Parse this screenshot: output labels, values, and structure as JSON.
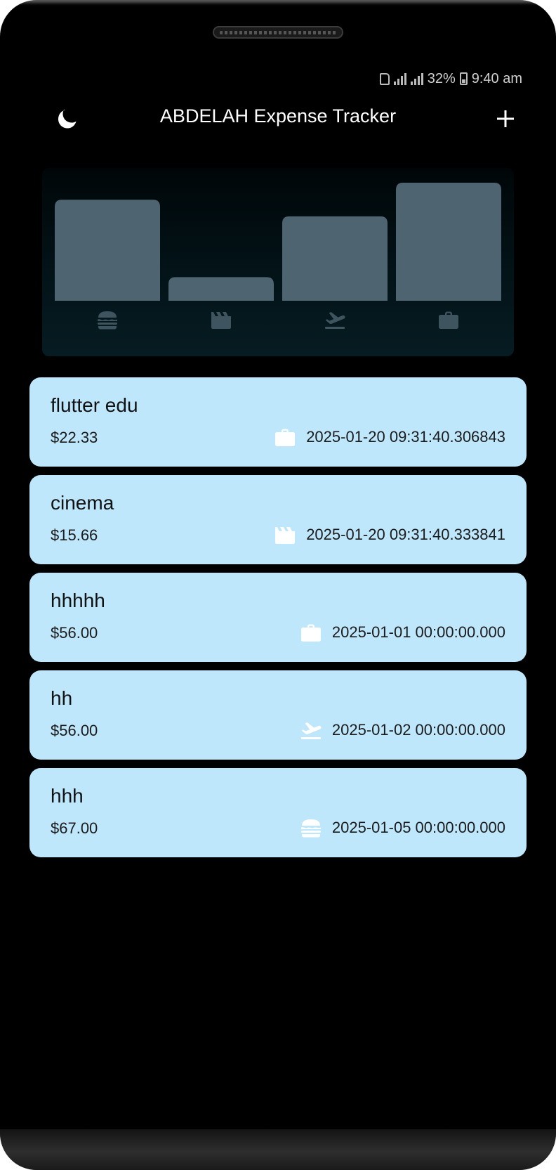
{
  "status": {
    "battery": "32%",
    "time": "9:40 am"
  },
  "app": {
    "title": "ABDELAH Expense Tracker",
    "theme_icon": "moon-icon",
    "add_icon": "plus-icon"
  },
  "colors": {
    "background": "#000000",
    "bar": "#4e6470",
    "chart_icon": "#3e545f",
    "card": "#bfe7fc",
    "card_icon": "#ffffff"
  },
  "chart_data": {
    "type": "bar",
    "categories": [
      "food",
      "leisure",
      "travel",
      "work"
    ],
    "category_icons": [
      "burger-icon",
      "clapperboard-icon",
      "flight-takeoff-icon",
      "briefcase-icon"
    ],
    "values": [
      67.0,
      15.66,
      56.0,
      78.33
    ],
    "ylim": [
      0,
      78.33
    ],
    "grid": false
  },
  "expenses": [
    {
      "title": "flutter edu",
      "amount": "$22.33",
      "category": "work",
      "icon": "briefcase-icon",
      "date": "2025-01-20 09:31:40.306843"
    },
    {
      "title": "cinema",
      "amount": "$15.66",
      "category": "leisure",
      "icon": "clapperboard-icon",
      "date": "2025-01-20 09:31:40.333841"
    },
    {
      "title": "hhhhh",
      "amount": "$56.00",
      "category": "work",
      "icon": "briefcase-icon",
      "date": "2025-01-01 00:00:00.000"
    },
    {
      "title": "hh",
      "amount": "$56.00",
      "category": "travel",
      "icon": "flight-takeoff-icon",
      "date": "2025-01-02 00:00:00.000"
    },
    {
      "title": "hhh",
      "amount": "$67.00",
      "category": "food",
      "icon": "burger-icon",
      "date": "2025-01-05 00:00:00.000"
    }
  ]
}
